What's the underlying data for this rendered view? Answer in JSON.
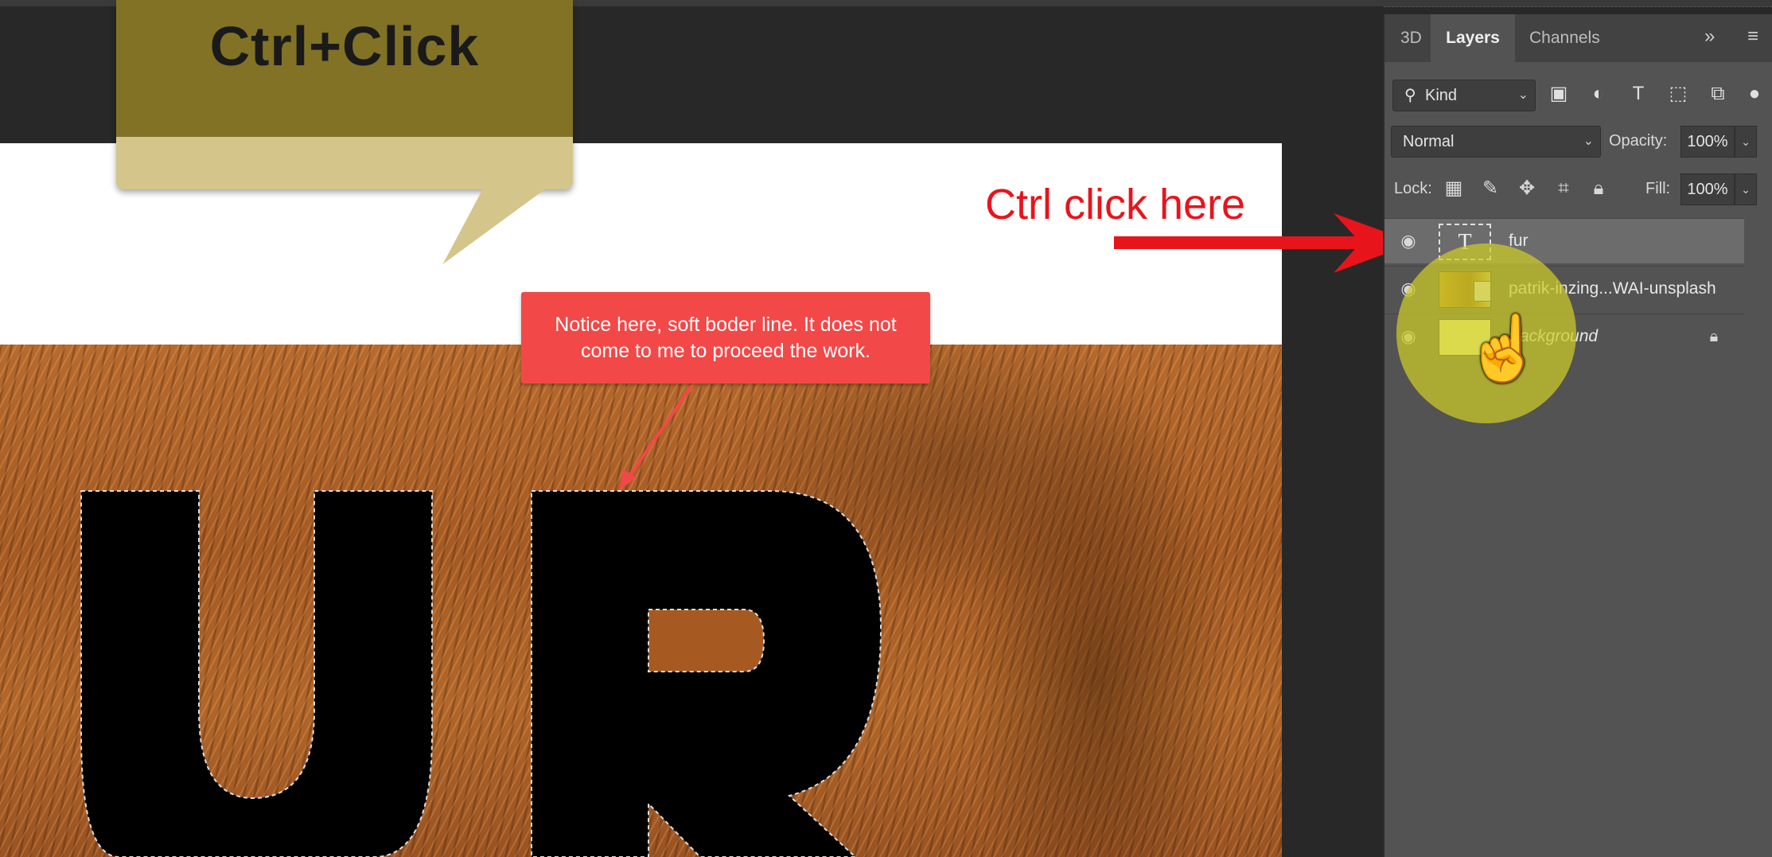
{
  "callout": {
    "text": "Ctrl+Click"
  },
  "note": {
    "text": "Notice here, soft boder line. It does not come to me to proceed the work."
  },
  "annotation": {
    "text": "Ctrl click here"
  },
  "canvas": {
    "letters": "UR"
  },
  "panel": {
    "tabs": [
      {
        "label": "3D"
      },
      {
        "label": "Layers"
      },
      {
        "label": "Channels"
      }
    ],
    "filter": {
      "kind_label": "Kind"
    },
    "blend": {
      "mode": "Normal",
      "opacity_label": "Opacity:",
      "opacity_value": "100%"
    },
    "lock": {
      "lock_label": "Lock:",
      "fill_label": "Fill:",
      "fill_value": "100%"
    },
    "layers": [
      {
        "name": "fur"
      },
      {
        "name": "patrik-inzing...WAI-unsplash"
      },
      {
        "name": "Background"
      }
    ]
  },
  "colors": {
    "accent_red": "#f24848",
    "annotation_red": "#e8141c",
    "highlight_yellow": "#cdcd28"
  }
}
